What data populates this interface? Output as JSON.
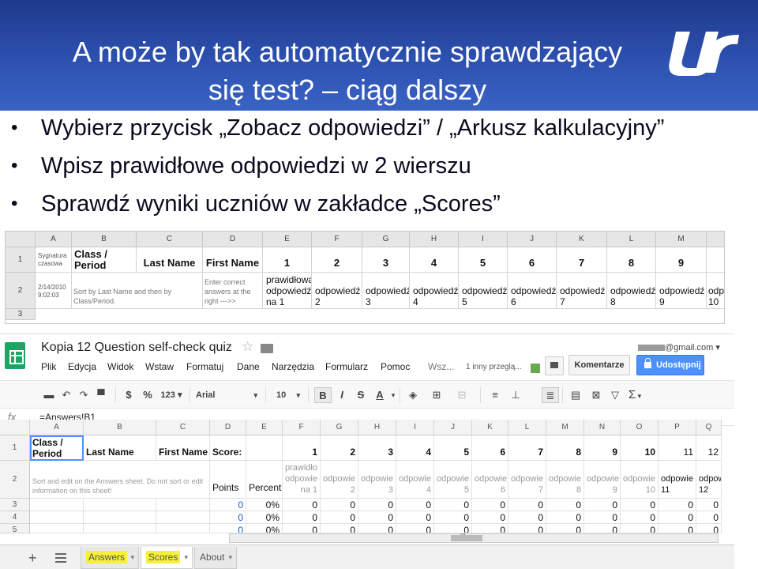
{
  "slide": {
    "title_line1": "A może by tak automatycznie sprawdzający",
    "title_line2": "się test? – ciąg dalszy",
    "bullets": [
      "Wybierz przycisk „Zobacz odpowiedzi” / „Arkusz kalkulacyjny”",
      "Wpisz prawidłowe odpowiedzi w 2 wierszu",
      "Sprawdź wyniki uczniów w zakładce „Scores”"
    ],
    "colors": {
      "band": "#2d51b0",
      "text": "#0a0a1e"
    }
  },
  "sheet1": {
    "columns": [
      "A",
      "B",
      "C",
      "D",
      "E",
      "F",
      "G",
      "H",
      "I",
      "J",
      "K",
      "L",
      "M"
    ],
    "rows": [
      "1",
      "2",
      "3"
    ],
    "r1": {
      "a": "Sygnatura czasowa",
      "b": "Class / Period",
      "c": "Last Name",
      "d": "First Name",
      "nums": [
        "1",
        "2",
        "3",
        "4",
        "5",
        "6",
        "7",
        "8",
        "9"
      ]
    },
    "r2": {
      "a": "2/14/2010 9:02:03",
      "b": "Sort by Last Name and then by Class/Period.",
      "d": "Enter correct answers at the right --->>",
      "e_line1": "prawidłowa",
      "e_line2": "odpowiedź",
      "e_line3": "na 1",
      "answers": [
        {
          "l1": "odpowiedź",
          "l2": "2"
        },
        {
          "l1": "odpowiedź",
          "l2": "3"
        },
        {
          "l1": "odpowiedź",
          "l2": "4"
        },
        {
          "l1": "odpowiedź",
          "l2": "5"
        },
        {
          "l1": "odpowiedź",
          "l2": "6"
        },
        {
          "l1": "odpowiedź",
          "l2": "7"
        },
        {
          "l1": "odpowiedź",
          "l2": "8"
        },
        {
          "l1": "odpowiedź",
          "l2": "9"
        },
        {
          "l1": "odp",
          "l2": "10"
        }
      ]
    }
  },
  "gsheets": {
    "doc_title": "Kopia 12 Question self-check quiz",
    "user_email": "@gmail.com",
    "menu": [
      "Plik",
      "Edycja",
      "Widok",
      "Wstaw",
      "Formatuj",
      "Dane",
      "Narzędzia",
      "Formularz",
      "Pomoc"
    ],
    "status_prefix": "Wsz...",
    "viewers": "1 inny przeglą...",
    "comment_button": "Komentarze",
    "share_button": "Udostępnij",
    "toolbar": {
      "currency": "$",
      "percent": "%",
      "number_format": "123",
      "font": "Arial",
      "size": "10",
      "bold": "B",
      "italic": "I",
      "strike": "S",
      "color": "A",
      "sigma": "Σ"
    },
    "formula": {
      "fx": "fx",
      "value": "=Answers!B1"
    },
    "columns": [
      "A",
      "B",
      "C",
      "D",
      "E",
      "F",
      "G",
      "H",
      "I",
      "J",
      "K",
      "L",
      "M",
      "N",
      "O",
      "P",
      "Q"
    ],
    "rows": [
      "1",
      "2",
      "3",
      "4",
      "5"
    ],
    "r1": {
      "a": "Class / Period",
      "b": "Last Name",
      "c": "First Name",
      "d": "Score:",
      "nums": [
        "1",
        "2",
        "3",
        "4",
        "5",
        "6",
        "7",
        "8",
        "9",
        "10",
        "11",
        "12"
      ]
    },
    "r2": {
      "note": "Sort and edit on the Answers sheet. Do not sort or edit information on this sheet!",
      "points": "Points",
      "percent": "Percent",
      "f_l1": "prawidło",
      "f_l2": "odpowie",
      "f_l3": "na 1",
      "answers": [
        {
          "l1": "odpowie",
          "l2": "2"
        },
        {
          "l1": "odpowie",
          "l2": "3"
        },
        {
          "l1": "odpowie",
          "l2": "4"
        },
        {
          "l1": "odpowie",
          "l2": "5"
        },
        {
          "l1": "odpowie",
          "l2": "6"
        },
        {
          "l1": "odpowie",
          "l2": "7"
        },
        {
          "l1": "odpowie",
          "l2": "8"
        },
        {
          "l1": "odpowie",
          "l2": "9"
        },
        {
          "l1": "odpowie",
          "l2": "10"
        },
        {
          "l1": "odpowie",
          "l2": "11"
        },
        {
          "l1": "odpowi",
          "l2": "12"
        }
      ]
    },
    "data_rows": [
      {
        "points": "0",
        "percent": "0%",
        "vals": [
          "0",
          "0",
          "0",
          "0",
          "0",
          "0",
          "0",
          "0",
          "0",
          "0",
          "0",
          "0"
        ]
      },
      {
        "points": "0",
        "percent": "0%",
        "vals": [
          "0",
          "0",
          "0",
          "0",
          "0",
          "0",
          "0",
          "0",
          "0",
          "0",
          "0",
          "0"
        ]
      },
      {
        "points": "0",
        "percent": "0%",
        "vals": [
          "0",
          "0",
          "0",
          "0",
          "0",
          "0",
          "0",
          "0",
          "0",
          "0",
          "0",
          "0"
        ]
      }
    ],
    "scroll_glyph": "III",
    "tabs": [
      "Answers",
      "Scores",
      "About"
    ]
  }
}
